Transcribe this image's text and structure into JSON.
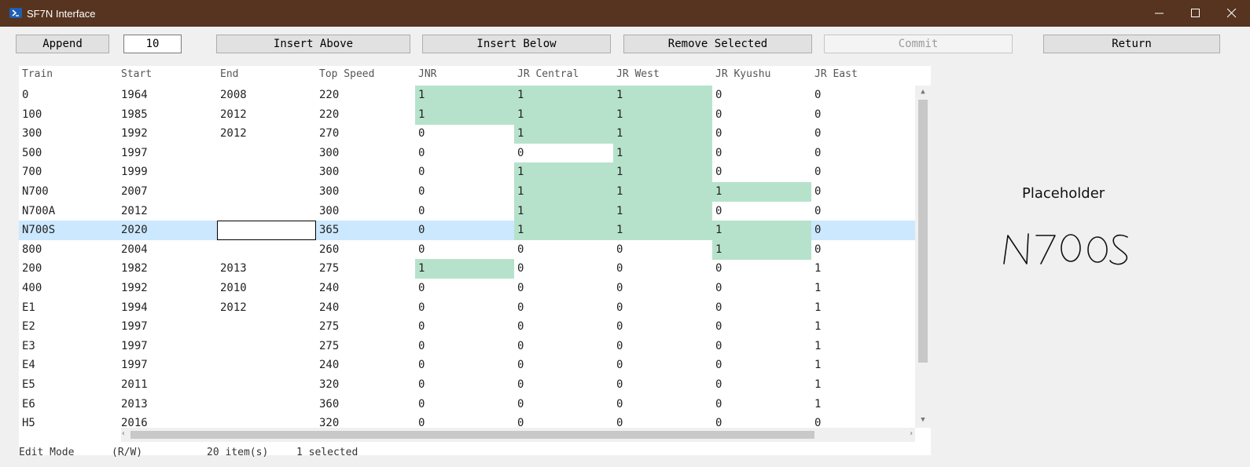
{
  "window": {
    "title": "SF7N Interface",
    "app_icon": "powershell-icon"
  },
  "toolbar": {
    "append": "Append",
    "count_value": "10",
    "insert_above": "Insert Above",
    "insert_below": "Insert Below",
    "remove_selected": "Remove Selected",
    "commit": "Commit",
    "return": "Return"
  },
  "table": {
    "headers": [
      "Train",
      "Start",
      "End",
      "Top Speed",
      "JNR",
      "JR Central",
      "JR West",
      "JR Kyushu",
      "JR East"
    ],
    "rows": [
      {
        "train": "0",
        "start": "1964",
        "end": "2008",
        "speed": "220",
        "jnr": "1",
        "central": "1",
        "west": "1",
        "kyushu": "0",
        "east": "0"
      },
      {
        "train": "100",
        "start": "1985",
        "end": "2012",
        "speed": "220",
        "jnr": "1",
        "central": "1",
        "west": "1",
        "kyushu": "0",
        "east": "0"
      },
      {
        "train": "300",
        "start": "1992",
        "end": "2012",
        "speed": "270",
        "jnr": "0",
        "central": "1",
        "west": "1",
        "kyushu": "0",
        "east": "0"
      },
      {
        "train": "500",
        "start": "1997",
        "end": "",
        "speed": "300",
        "jnr": "0",
        "central": "0",
        "west": "1",
        "kyushu": "0",
        "east": "0"
      },
      {
        "train": "700",
        "start": "1999",
        "end": "",
        "speed": "300",
        "jnr": "0",
        "central": "1",
        "west": "1",
        "kyushu": "0",
        "east": "0"
      },
      {
        "train": "N700",
        "start": "2007",
        "end": "",
        "speed": "300",
        "jnr": "0",
        "central": "1",
        "west": "1",
        "kyushu": "1",
        "east": "0"
      },
      {
        "train": "N700A",
        "start": "2012",
        "end": "",
        "speed": "300",
        "jnr": "0",
        "central": "1",
        "west": "1",
        "kyushu": "0",
        "east": "0"
      },
      {
        "train": "N700S",
        "start": "2020",
        "end": "",
        "speed": "365",
        "jnr": "0",
        "central": "1",
        "west": "1",
        "kyushu": "1",
        "east": "0"
      },
      {
        "train": "800",
        "start": "2004",
        "end": "",
        "speed": "260",
        "jnr": "0",
        "central": "0",
        "west": "0",
        "kyushu": "1",
        "east": "0"
      },
      {
        "train": "200",
        "start": "1982",
        "end": "2013",
        "speed": "275",
        "jnr": "1",
        "central": "0",
        "west": "0",
        "kyushu": "0",
        "east": "1"
      },
      {
        "train": "400",
        "start": "1992",
        "end": "2010",
        "speed": "240",
        "jnr": "0",
        "central": "0",
        "west": "0",
        "kyushu": "0",
        "east": "1"
      },
      {
        "train": "E1",
        "start": "1994",
        "end": "2012",
        "speed": "240",
        "jnr": "0",
        "central": "0",
        "west": "0",
        "kyushu": "0",
        "east": "1"
      },
      {
        "train": "E2",
        "start": "1997",
        "end": "",
        "speed": "275",
        "jnr": "0",
        "central": "0",
        "west": "0",
        "kyushu": "0",
        "east": "1"
      },
      {
        "train": "E3",
        "start": "1997",
        "end": "",
        "speed": "275",
        "jnr": "0",
        "central": "0",
        "west": "0",
        "kyushu": "0",
        "east": "1"
      },
      {
        "train": "E4",
        "start": "1997",
        "end": "",
        "speed": "240",
        "jnr": "0",
        "central": "0",
        "west": "0",
        "kyushu": "0",
        "east": "1"
      },
      {
        "train": "E5",
        "start": "2011",
        "end": "",
        "speed": "320",
        "jnr": "0",
        "central": "0",
        "west": "0",
        "kyushu": "0",
        "east": "1"
      },
      {
        "train": "E6",
        "start": "2013",
        "end": "",
        "speed": "360",
        "jnr": "0",
        "central": "0",
        "west": "0",
        "kyushu": "0",
        "east": "1"
      },
      {
        "train": "H5",
        "start": "2016",
        "end": "",
        "speed": "320",
        "jnr": "0",
        "central": "0",
        "west": "0",
        "kyushu": "0",
        "east": "0"
      }
    ],
    "selected_row": 7,
    "highlight_color": "#b6e2cc",
    "selection_color": "#cce8ff"
  },
  "preview": {
    "title": "Placeholder",
    "handwriting": "N700S"
  },
  "status": {
    "mode": "Edit Mode",
    "access": "(R/W)",
    "count": "20 item(s)",
    "selected": "1 selected"
  }
}
